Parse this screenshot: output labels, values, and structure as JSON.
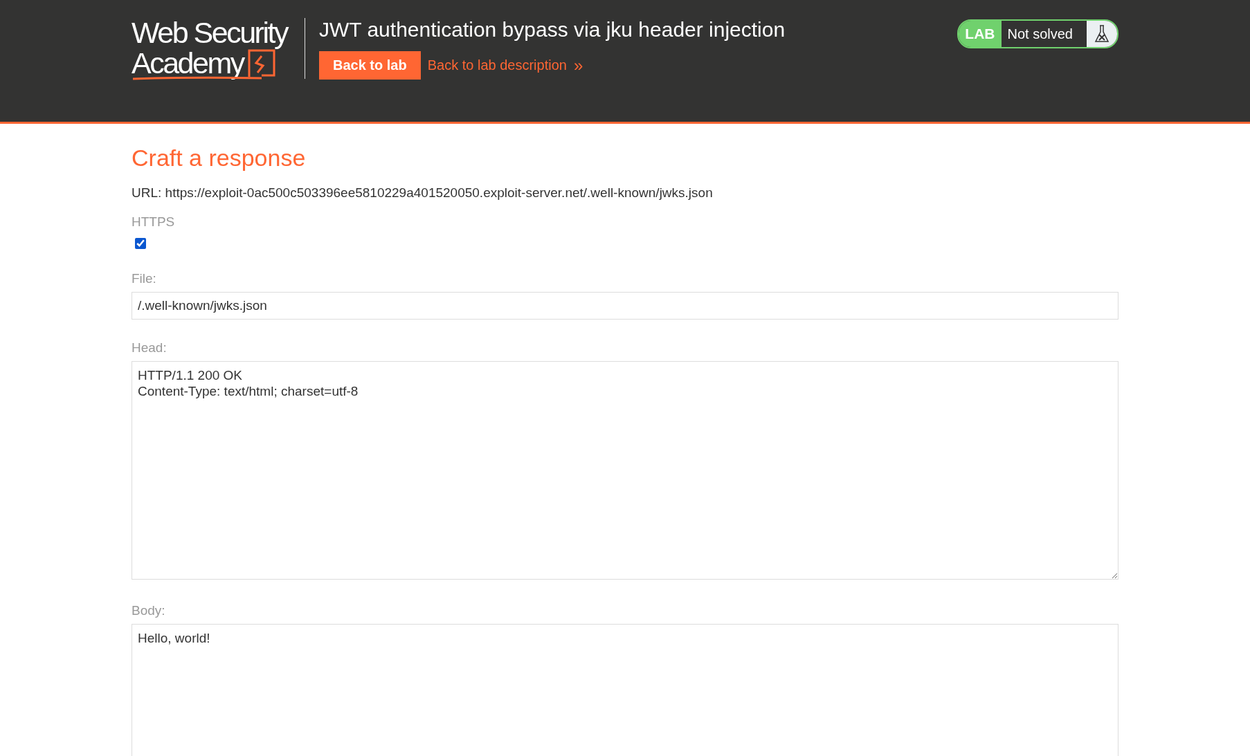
{
  "header": {
    "logo": [
      "Web Security",
      "Academy"
    ],
    "title": "JWT authentication bypass via jku header injection",
    "back_button": "Back to lab",
    "description_link": "Back to lab description",
    "link_arrow": "»",
    "status": {
      "label": "LAB",
      "text": "Not solved",
      "solved": false
    }
  },
  "form": {
    "heading": "Craft a response",
    "url": "URL: https://exploit-0ac500c503396ee5810229a401520050.exploit-server.net/.well-known/jwks.json",
    "https": {
      "label": "HTTPS",
      "checked": true
    },
    "file": {
      "label": "File:",
      "value": "/.well-known/jwks.json"
    },
    "head": {
      "label": "Head:",
      "value": "HTTP/1.1 200 OK\nContent-Type: text/html; charset=utf-8"
    },
    "body": {
      "label": "Body:",
      "value": "Hello, world!"
    }
  }
}
